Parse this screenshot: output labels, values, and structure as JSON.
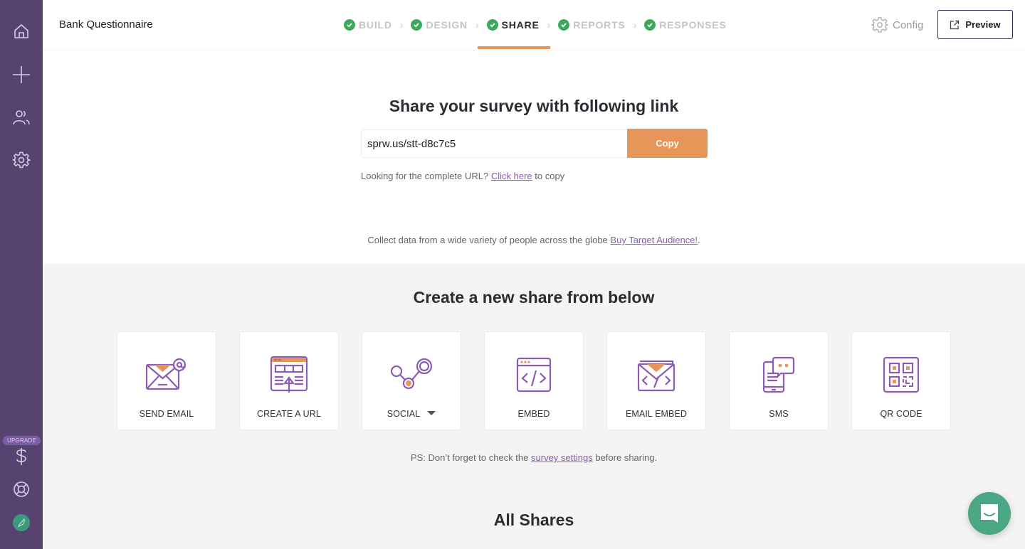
{
  "sidebar": {
    "items": [
      {
        "name": "home-icon"
      },
      {
        "name": "plus-icon"
      },
      {
        "name": "users-icon"
      },
      {
        "name": "settings-icon"
      }
    ],
    "upgrade_label": "UPGRADE",
    "bottom_items": [
      {
        "name": "dollar-icon"
      },
      {
        "name": "help-lifebuoy-icon"
      }
    ]
  },
  "header": {
    "survey_title": "Bank Questionnaire",
    "steps": [
      {
        "label": "BUILD",
        "completed": true,
        "active": false
      },
      {
        "label": "DESIGN",
        "completed": true,
        "active": false
      },
      {
        "label": "SHARE",
        "completed": true,
        "active": true
      },
      {
        "label": "REPORTS",
        "completed": true,
        "active": false
      },
      {
        "label": "RESPONSES",
        "completed": true,
        "active": false
      }
    ],
    "config_label": "Config",
    "preview_label": "Preview"
  },
  "share_link": {
    "title": "Share your survey with following link",
    "url_value": "sprw.us/stt-d8c7c5",
    "copy_label": "Copy",
    "full_url_prefix": "Looking for the complete URL?",
    "full_url_link": "Click here",
    "full_url_suffix": "to copy",
    "collect_text": "Collect data from a wide variety of people across the globe",
    "collect_link": "Buy Target Audience!",
    "collect_suffix": "."
  },
  "create_share": {
    "title": "Create a new share from below",
    "options": [
      {
        "label": "SEND EMAIL",
        "icon": "send-email-icon"
      },
      {
        "label": "CREATE A URL",
        "icon": "create-url-icon"
      },
      {
        "label": "SOCIAL",
        "icon": "social-icon",
        "has_dropdown": true
      },
      {
        "label": "EMBED",
        "icon": "embed-code-icon"
      },
      {
        "label": "EMAIL EMBED",
        "icon": "email-embed-icon"
      },
      {
        "label": "SMS",
        "icon": "sms-icon"
      },
      {
        "label": "QR CODE",
        "icon": "qr-code-icon"
      }
    ],
    "ps_prefix": "PS: Don’t forget to check the",
    "ps_link": "survey settings",
    "ps_suffix": "before sharing."
  },
  "all_shares": {
    "title": "All Shares"
  },
  "colors": {
    "sidebar": "#56436f",
    "accent_orange": "#e69658",
    "accent_purple": "#8c5bb5",
    "check_green": "#3ca95a",
    "chat_green": "#4aa683"
  }
}
